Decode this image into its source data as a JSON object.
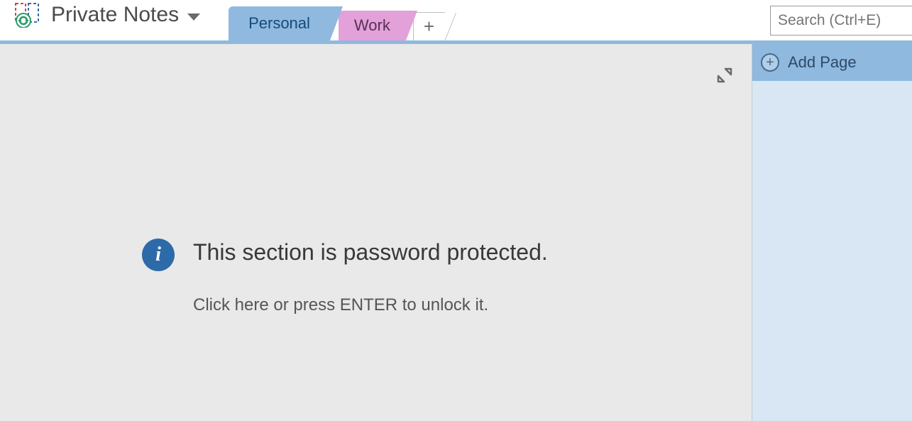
{
  "notebook": {
    "title": "Private Notes"
  },
  "tabs": {
    "active": "Personal",
    "second": "Work"
  },
  "search": {
    "placeholder": "Search (Ctrl+E)"
  },
  "content": {
    "heading": "This section is password protected.",
    "subtext": "Click here or press ENTER to unlock it."
  },
  "pagepanel": {
    "add_label": "Add Page"
  }
}
